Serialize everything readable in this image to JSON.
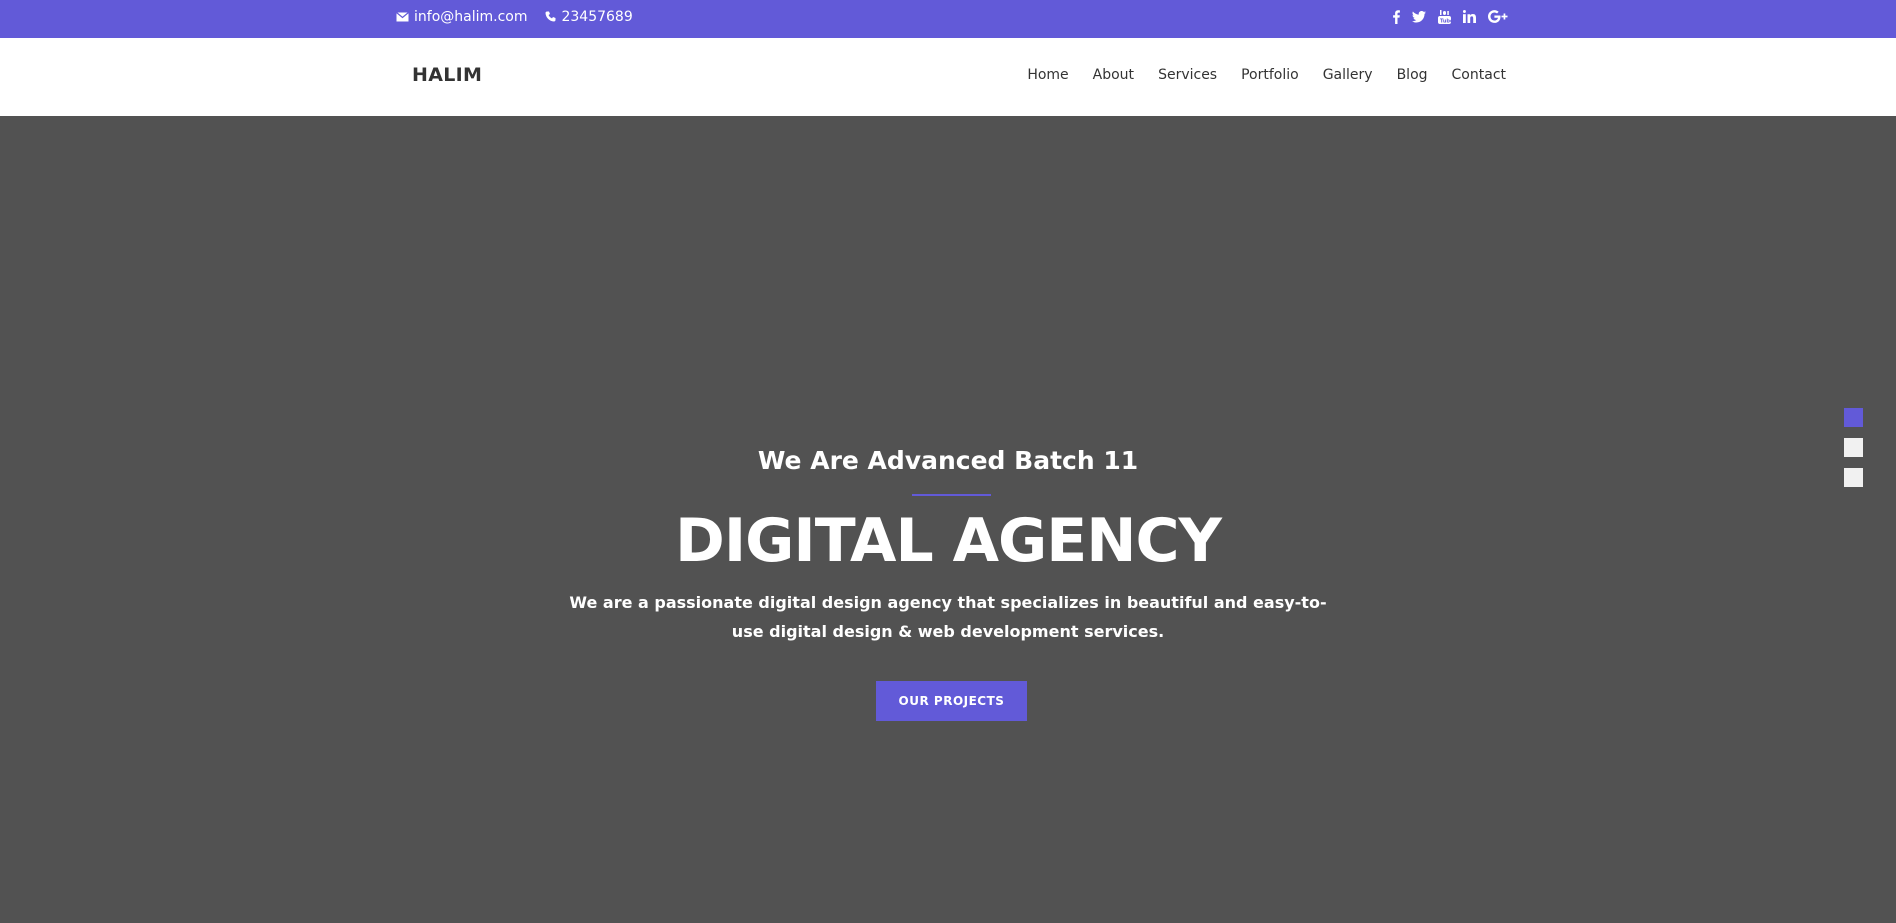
{
  "topbar": {
    "email": "info@halim.com",
    "phone": "23457689",
    "email_icon": "envelope-icon",
    "phone_icon": "phone-icon",
    "social": [
      "facebook-icon",
      "twitter-icon",
      "youtube-icon",
      "linkedin-icon",
      "google-plus-icon"
    ]
  },
  "brand": {
    "logo": "HALIM"
  },
  "nav": {
    "items": [
      "Home",
      "About",
      "Services",
      "Portfolio",
      "Gallery",
      "Blog",
      "Contact"
    ]
  },
  "hero": {
    "subtitle": "We Are Advanced Batch 11",
    "title": "DIGITAL AGENCY",
    "description": "We are a passionate digital design agency that specializes in beautiful and easy-to-use digital design & web development services.",
    "button_label": "OUR PROJECTS"
  },
  "slider": {
    "slides": 3,
    "active_index": 0
  },
  "colors": {
    "accent": "#625ad8",
    "hero_bg": "#525252",
    "text_dark": "#333333"
  }
}
